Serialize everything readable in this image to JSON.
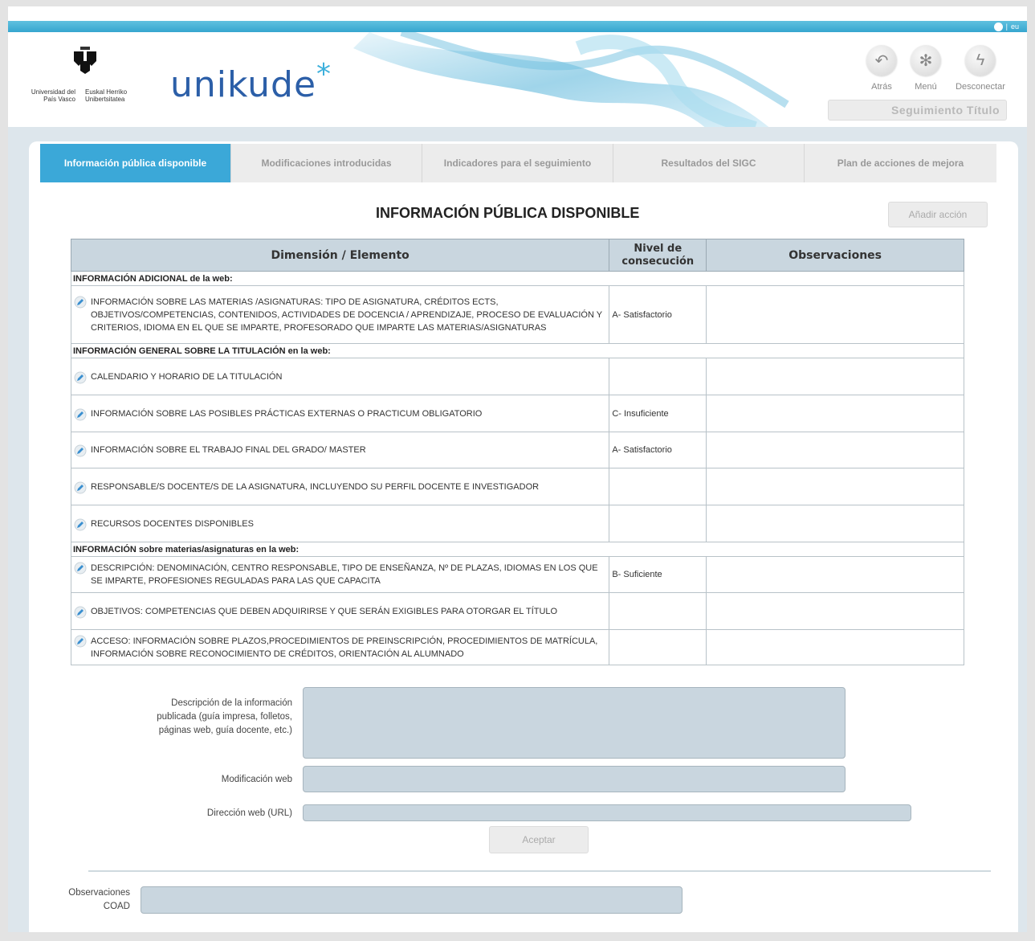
{
  "header": {
    "lang": "eu",
    "university_es": "Universidad del País Vasco",
    "university_eu": "Euskal Herriko Unibertsitatea",
    "app_name": "unikude",
    "nav": [
      {
        "label": "Atrás",
        "icon": "back-arrow-icon"
      },
      {
        "label": "Menú",
        "icon": "asterisk-menu-icon"
      },
      {
        "label": "Desconectar",
        "icon": "lightning-icon"
      }
    ],
    "section_title": "Seguimiento Título"
  },
  "tabs": [
    {
      "label": "Información pública disponible",
      "active": true
    },
    {
      "label": "Modificaciones introducidas",
      "active": false
    },
    {
      "label": "Indicadores para el seguimiento",
      "active": false
    },
    {
      "label": "Resultados del SIGC",
      "active": false
    },
    {
      "label": "Plan de acciones de mejora",
      "active": false
    }
  ],
  "main": {
    "title": "INFORMACIÓN PÚBLICA DISPONIBLE",
    "add_action_label": "Añadir acción",
    "table": {
      "headers": {
        "elemento": "Dimensión / Elemento",
        "nivel": "Nivel de consecución",
        "obs": "Observaciones"
      },
      "sections": [
        {
          "title": "INFORMACIÓN ADICIONAL de la web:",
          "rows": [
            {
              "text": "INFORMACIÓN SOBRE LAS MATERIAS /ASIGNATURAS: TIPO DE ASIGNATURA, CRÉDITOS ECTS, OBJETIVOS/COMPETENCIAS, CONTENIDOS, ACTIVIDADES DE DOCENCIA / APRENDIZAJE, PROCESO DE EVALUACIÓN Y CRITERIOS, IDIOMA EN EL QUE SE IMPARTE, PROFESORADO QUE IMPARTE LAS MATERIAS/ASIGNATURAS",
              "nivel": "A- Satisfactorio",
              "obs": ""
            }
          ]
        },
        {
          "title": "INFORMACIÓN GENERAL SOBRE LA TITULACIÓN en la web:",
          "rows": [
            {
              "text": "CALENDARIO Y HORARIO DE LA TITULACIÓN",
              "nivel": "",
              "obs": ""
            },
            {
              "text": "INFORMACIÓN SOBRE LAS POSIBLES PRÁCTICAS EXTERNAS O PRACTICUM OBLIGATORIO",
              "nivel": "C- Insuficiente",
              "obs": ""
            },
            {
              "text": "INFORMACIÓN SOBRE EL TRABAJO FINAL DEL GRADO/ MASTER",
              "nivel": "A- Satisfactorio",
              "obs": ""
            },
            {
              "text": "RESPONSABLE/S DOCENTE/S DE LA ASIGNATURA, INCLUYENDO SU PERFIL DOCENTE E INVESTIGADOR",
              "nivel": "",
              "obs": ""
            },
            {
              "text": "RECURSOS DOCENTES DISPONIBLES",
              "nivel": "",
              "obs": ""
            }
          ]
        },
        {
          "title": "INFORMACIÓN sobre materias/asignaturas en la web:",
          "rows": [
            {
              "text": "DESCRIPCIÓN: DENOMINACIÓN, CENTRO RESPONSABLE, TIPO DE ENSEÑANZA, Nº DE PLAZAS, IDIOMAS EN LOS QUE SE IMPARTE, PROFESIONES REGULADAS PARA LAS QUE CAPACITA",
              "nivel": "B- Suficiente",
              "obs": ""
            },
            {
              "text": "OBJETIVOS: COMPETENCIAS QUE DEBEN ADQUIRIRSE Y QUE SERÁN EXIGIBLES PARA OTORGAR EL TÍTULO",
              "nivel": "",
              "obs": ""
            },
            {
              "text": "ACCESO: INFORMACIÓN SOBRE PLAZOS,PROCEDIMIENTOS DE PREINSCRIPCIÓN, PROCEDIMIENTOS DE MATRÍCULA, INFORMACIÓN SOBRE RECONOCIMIENTO DE CRÉDITOS, ORIENTACIÓN AL ALUMNADO",
              "nivel": "",
              "obs": ""
            }
          ]
        }
      ]
    },
    "form": {
      "descripcion_label": "Descripción de la información publicada (guía impresa, folletos, páginas web, guía docente, etc.)",
      "descripcion_value": "",
      "modificacion_label": "Modificación web",
      "modificacion_value": "",
      "url_label": "Dirección web (URL)",
      "url_value": "",
      "accept_label": "Aceptar"
    },
    "coad": {
      "label": "Observaciones COAD",
      "value": ""
    }
  }
}
